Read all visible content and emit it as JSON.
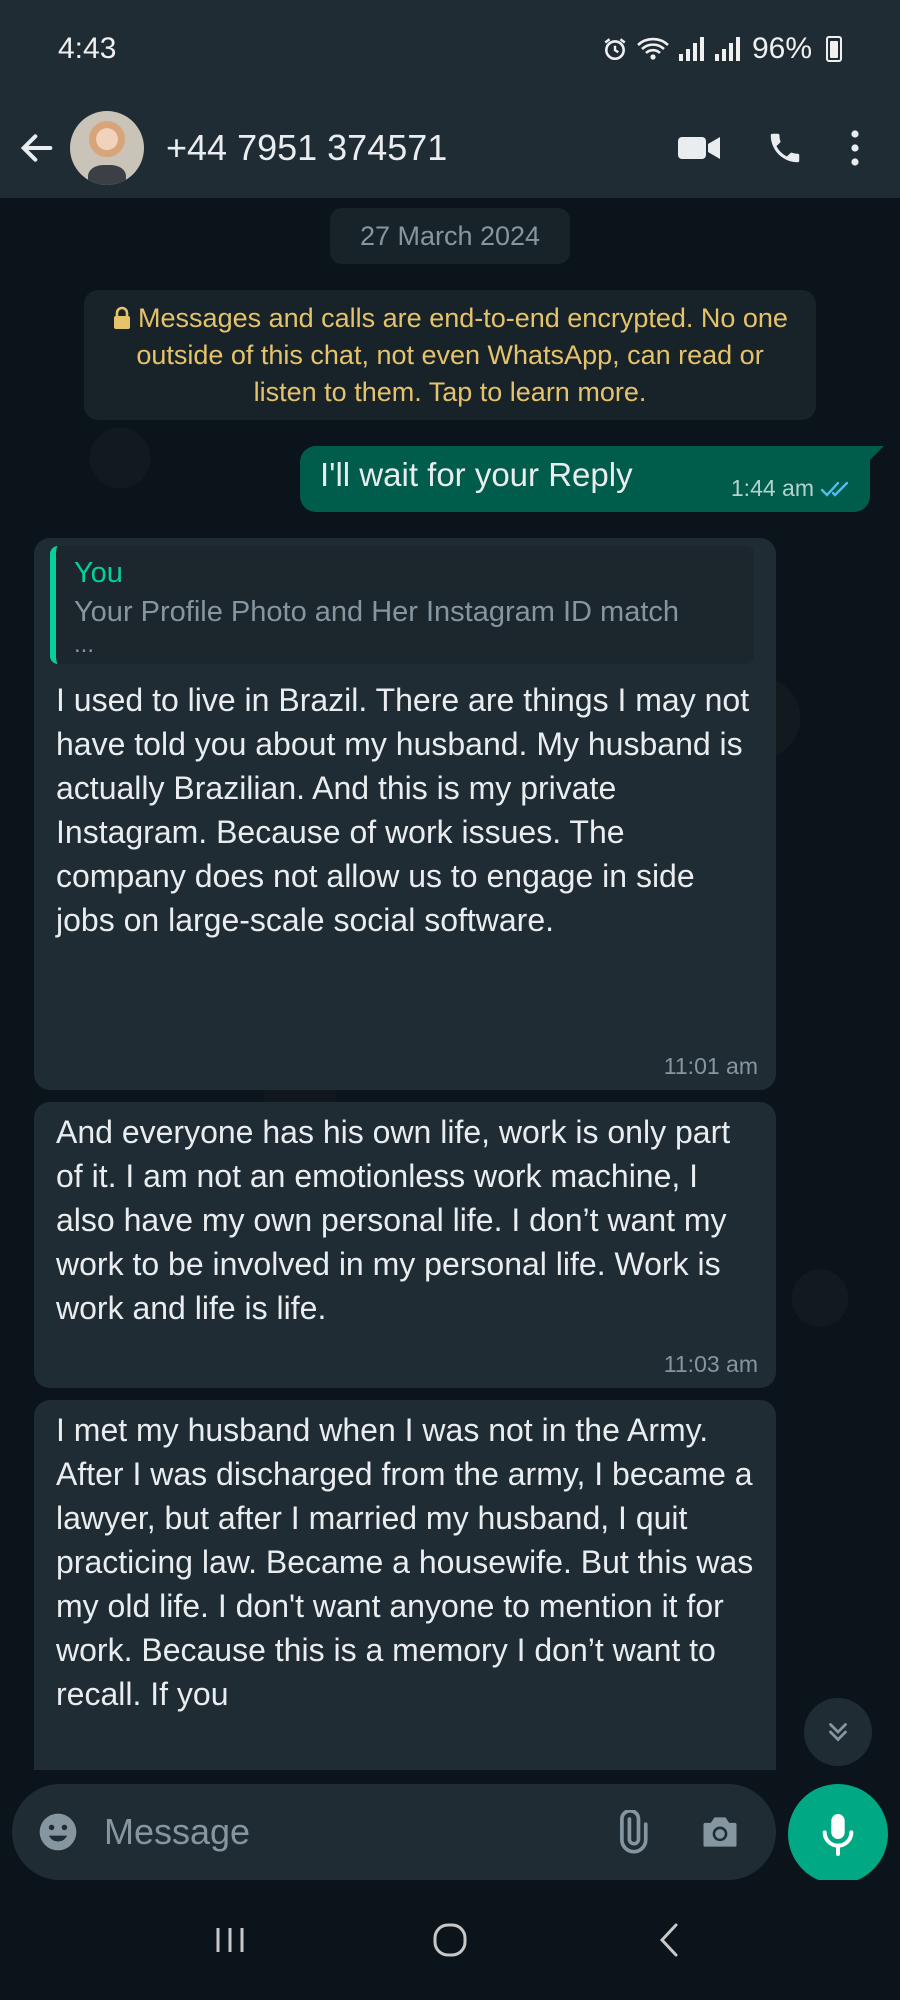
{
  "status_bar": {
    "time": "4:43",
    "battery": "96%"
  },
  "header": {
    "contact_name": "+44 7951 374571"
  },
  "chat": {
    "date_chip": "27 March 2024",
    "encryption_notice": "Messages and calls are end-to-end encrypted. No one outside of this chat, not even WhatsApp, can read or listen to them. Tap to learn more.",
    "messages": [
      {
        "direction": "outgoing",
        "text": "I'll wait for your Reply",
        "time": "1:44 am",
        "status": "delivered"
      },
      {
        "direction": "incoming",
        "quote_author": "You",
        "quote_text": "Your Profile Photo and Her Instagram ID match",
        "quote_ellipsis": "...",
        "text": "I used to live in Brazil. There are things I may not have told you about my husband. My husband is actually Brazilian. And this is my private Instagram. Because of work issues. The company does not allow us to engage in side jobs on large-scale social software.",
        "time": "11:01 am"
      },
      {
        "direction": "incoming",
        "text": "And everyone has his own life, work is only part of it. I am not an emotionless work machine, I also have my own personal life. I don’t want my work to be involved in my personal life. Work is work and life is life.",
        "time": "11:03 am"
      },
      {
        "direction": "incoming",
        "text": "I met my husband when I was not in the Army. After I was discharged from the army, I became a lawyer, but after I married my husband, I quit practicing law. Became a housewife. But this was my old life. I don't want anyone to mention it for work. Because this is a memory I don’t want to recall. If you"
      }
    ]
  },
  "composer": {
    "placeholder": "Message"
  },
  "colors": {
    "background": "#0b141a",
    "header": "#1f2c34",
    "incoming_bubble": "#202c33",
    "outgoing_bubble": "#005c4b",
    "accent": "#00a884",
    "notice_text": "#e5c36a",
    "read_ticks": "#53bdeb"
  },
  "icons": {
    "back": "arrow-left-icon",
    "video": "video-camera-icon",
    "call": "phone-icon",
    "menu": "more-vertical-icon",
    "emoji": "emoji-icon",
    "attach": "paperclip-icon",
    "camera": "camera-icon",
    "mic": "microphone-icon",
    "scroll": "chevron-double-down-icon"
  }
}
